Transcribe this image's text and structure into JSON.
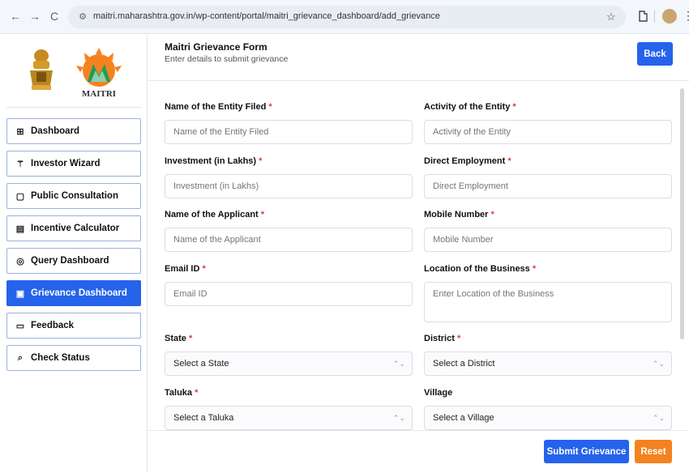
{
  "browser": {
    "url": "maitri.maharashtra.gov.in/wp-content/portal/maitri_grievance_dashboard/add_grievance",
    "back_glyph": "←",
    "forward_glyph": "→",
    "reload_glyph": "C"
  },
  "sidebar": {
    "logo_text": "MAITRI",
    "items": [
      {
        "label": "Dashboard",
        "icon": "grid-icon"
      },
      {
        "label": "Investor Wizard",
        "icon": "magic-wand-icon"
      },
      {
        "label": "Public Consultation",
        "icon": "document-icon"
      },
      {
        "label": "Incentive Calculator",
        "icon": "calculator-icon"
      },
      {
        "label": "Query Dashboard",
        "icon": "chat-icon"
      },
      {
        "label": "Grievance Dashboard",
        "icon": "file-icon",
        "active": true
      },
      {
        "label": "Feedback",
        "icon": "message-icon"
      },
      {
        "label": "Check Status",
        "icon": "search-icon"
      }
    ]
  },
  "form": {
    "title": "Maitri Grievance Form",
    "subtitle": "Enter details to submit grievance",
    "back_label": "Back",
    "fields": {
      "entity_name": {
        "label": "Name of the Entity Filed",
        "placeholder": "Name of the Entity Filed"
      },
      "activity": {
        "label": "Activity of the Entity",
        "placeholder": "Activity of the Entity"
      },
      "investment": {
        "label": "Investment (in Lakhs)",
        "placeholder": "Investment (in Lakhs)"
      },
      "employment": {
        "label": "Direct Employment",
        "placeholder": "Direct Employment"
      },
      "applicant": {
        "label": "Name of the Applicant",
        "placeholder": "Name of the Applicant"
      },
      "mobile": {
        "label": "Mobile Number",
        "placeholder": "Mobile Number"
      },
      "email": {
        "label": "Email ID",
        "placeholder": "Email ID"
      },
      "location": {
        "label": "Location of the Business",
        "placeholder": "Enter Location of the Business"
      },
      "state": {
        "label": "State",
        "value": "Select a State"
      },
      "district": {
        "label": "District",
        "value": "Select a District"
      },
      "taluka": {
        "label": "Taluka",
        "value": "Select a Taluka"
      },
      "village": {
        "label": "Village",
        "value": "Select a Village"
      }
    },
    "required_mark": "*",
    "submit_label": "Submit Grievance",
    "reset_label": "Reset"
  },
  "colors": {
    "primary": "#2563eb",
    "reset": "#f58220",
    "required": "#e53935"
  }
}
